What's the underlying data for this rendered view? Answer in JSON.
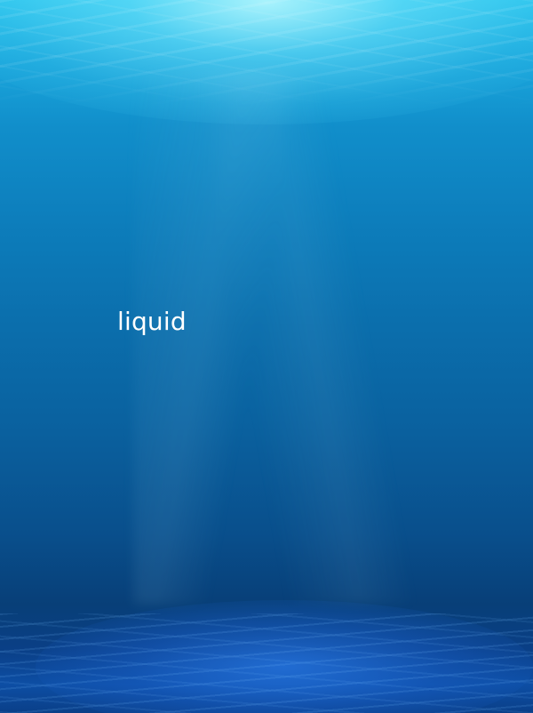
{
  "scene": {
    "description_word": "liquid",
    "colors": {
      "surface_light": "#2fc8ef",
      "mid_water": "#0b6fad",
      "deep_water": "#083f78",
      "floor_glow": "#0d4ea4",
      "text": "#ffffff"
    }
  }
}
